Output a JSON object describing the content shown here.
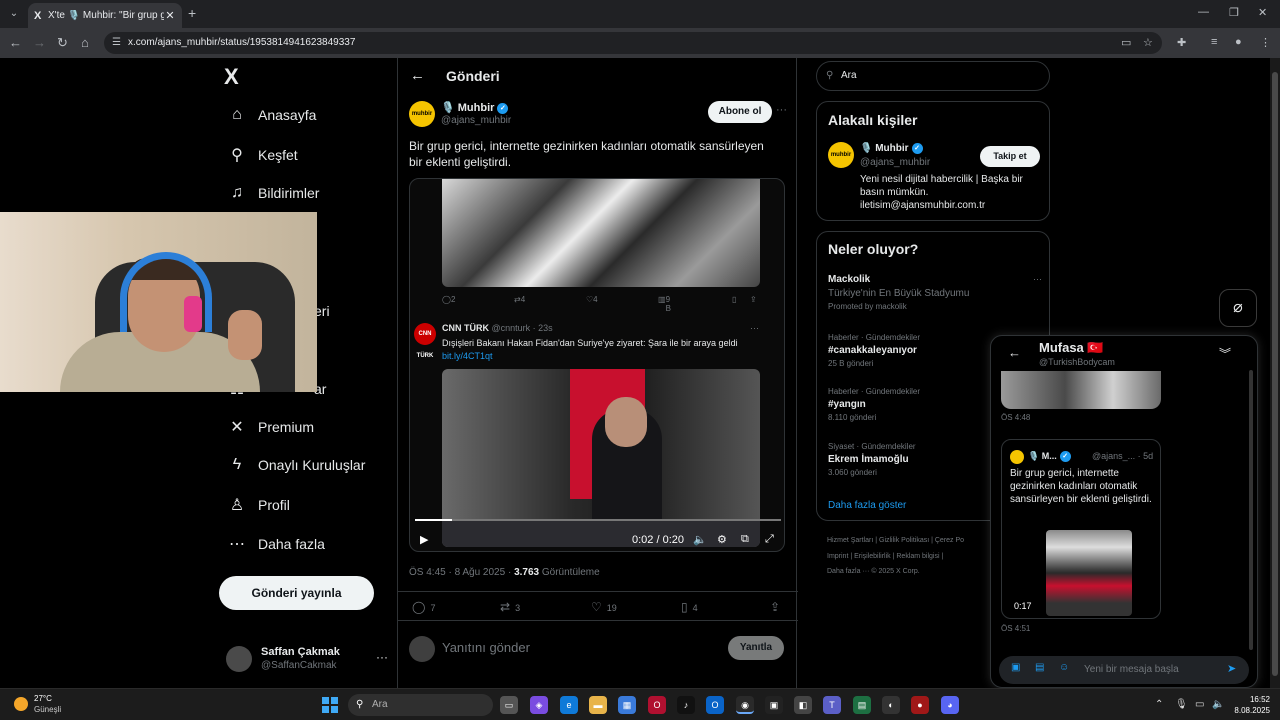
{
  "browser": {
    "tab_title": "X'te 🎙️ Muhbir: \"Bir grup gerici",
    "tab_logo": "X",
    "url": "x.com/ajans_muhbir/status/1953814941623849337",
    "icons": [
      "back-icon",
      "forward-icon",
      "reload-icon",
      "home-icon",
      "site-info-icon",
      "cast-icon",
      "star-icon",
      "extensions-icon",
      "media-icon",
      "profile-icon",
      "menu-icon"
    ]
  },
  "nav": {
    "logo": "X",
    "items": [
      {
        "label": "Anasayfa",
        "icon": "home-icon"
      },
      {
        "label": "Keşfet",
        "icon": "search-icon"
      },
      {
        "label": "Bildirimler",
        "icon": "bell-icon"
      },
      {
        "label": "eri",
        "icon": "messages-icon"
      },
      {
        "label": "ar",
        "icon": "communities-icon"
      },
      {
        "label": "Premium",
        "icon": "x-icon"
      },
      {
        "label": "Onaylı Kuruluşlar",
        "icon": "lightning-icon"
      },
      {
        "label": "Profil",
        "icon": "person-icon"
      },
      {
        "label": "Daha fazla",
        "icon": "more-circle-icon"
      }
    ],
    "post_button": "Gönderi yayınla",
    "user": {
      "name": "Saffan Çakmak",
      "handle": "@SaffanCakmak",
      "more": "···"
    }
  },
  "main": {
    "header_title": "Gönderi",
    "tweet": {
      "name": "🎙️ Muhbir",
      "handle": "@ajans_muhbir",
      "avatar_text": "muhbir",
      "subscribe": "Abone ol",
      "text": "Bir grup gerici, internette gezinirken kadınları otomatik sansürleyen bir eklenti geliştirdi.",
      "embed_counts": {
        "replies": "2",
        "retweets": "4",
        "likes": "4",
        "views": "9 B"
      },
      "cnn": {
        "logo": "CNN TÜRK",
        "name": "CNN TÜRK",
        "handle": "@cnnturk · 23s",
        "text": "Dışişleri Bakanı Hakan Fidan'dan Suriye'ye ziyaret: Şara ile bir araya geldi",
        "link": "bit.ly/4CT1qt"
      },
      "video_time": "0:02 / 0:20",
      "video_progress": 0.1,
      "time": "ÖS 4:45 · 8 Ağu 2025 ·",
      "views_count": "3.763",
      "views_label": "Görüntüleme",
      "stats": {
        "replies": "7",
        "retweets": "3",
        "likes": "19",
        "bookmarks": "4"
      }
    },
    "reply_placeholder": "Yanıtını gönder",
    "reply_button": "Yanıtla"
  },
  "right": {
    "search_placeholder": "Ara",
    "related_title": "Alakalı kişiler",
    "related_person": {
      "name": "🎙️ Muhbir",
      "handle": "@ajans_muhbir",
      "follow": "Takip et",
      "bio": "Yeni nesil dijital habercilik | Başka bir basın mümkün. iletisim@ajansmuhbir.com.tr"
    },
    "trends_title": "Neler oluyor?",
    "trends": [
      {
        "kicker": "Mackolik",
        "title": "Türkiye'nin En Büyük Stadyumu",
        "sub": "Promoted by mackolik"
      },
      {
        "kicker": "Haberler · Gündemdekiler",
        "title": "#canakkaleyanıyor",
        "sub": "25 B gönderi"
      },
      {
        "kicker": "Haberler · Gündemdekiler",
        "title": "#yangın",
        "sub": "8.110 gönderi"
      },
      {
        "kicker": "Siyaset · Gündemdekiler",
        "title": "Ekrem İmamoğlu",
        "sub": "3.060 gönderi"
      }
    ],
    "show_more": "Daha fazla göster",
    "footer": [
      "Hizmet Şartları  |  Gizlilik Politikası  |  Çerez Po",
      "Imprint  |  Erişilebilirlik  |  Reklam bilgisi  |",
      "Daha fazla ···   © 2025 X Corp."
    ]
  },
  "dm": {
    "name": "Mufasa 🇹🇷",
    "handle": "@TurkishBodycam",
    "time1": "ÖS 4:48",
    "bubble_name": "🎙️ M...",
    "bubble_handle": "@ajans_... · 5d",
    "bubble_text": "Bir grup gerici, internette gezinirken kadınları otomatik sansürleyen bir eklenti geliştirdi.",
    "bubble_video_time": "0:17",
    "time2": "ÖS 4:51",
    "input_placeholder": "Yeni bir mesaja başla"
  },
  "taskbar": {
    "weather_temp": "27°C",
    "weather_desc": "Güneşli",
    "search": "Ara",
    "clock_time": "16:52",
    "clock_date": "8.08.2025"
  },
  "colors": {
    "accent": "#1d9bf0",
    "background": "#000000",
    "border": "#2f3336"
  }
}
